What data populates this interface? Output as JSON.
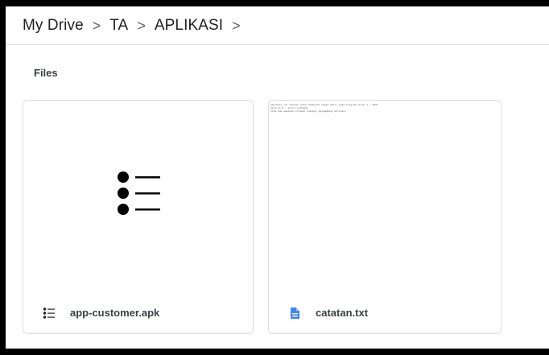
{
  "breadcrumb": {
    "items": [
      "My Drive",
      "TA",
      "APLIKASI"
    ],
    "separator": ">"
  },
  "section": {
    "title": "Files"
  },
  "files": [
    {
      "name": "app-customer.apk",
      "icon": "list-icon",
      "thumbnail": "list-icon"
    },
    {
      "name": "catatan.txt",
      "icon": "document-icon",
      "icon_color": "#4285f4",
      "preview_lines": [
        "Aplikasi ini dibuat untuk memenuhi tugas akhir pada program studi 1 / 2023",
        "Versi 1.0 - build customer",
        "Jika ada masalah silakan hubungi pengembang aplikasi"
      ]
    }
  ]
}
